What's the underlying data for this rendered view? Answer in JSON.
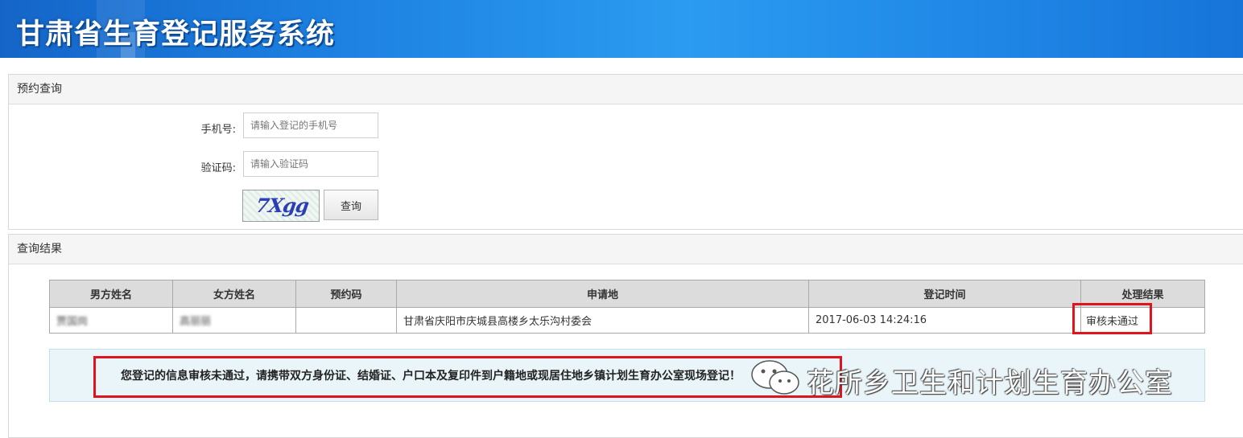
{
  "header": {
    "title": "甘肃省生育登记服务系统"
  },
  "query_panel": {
    "title": "预约查询",
    "phone_label": "手机号:",
    "phone_placeholder": "请输入登记的手机号",
    "code_label": "验证码:",
    "code_placeholder": "请输入验证码",
    "captcha_text": "7Xgg",
    "query_button": "查询"
  },
  "result_panel": {
    "title": "查询结果",
    "columns": [
      "男方姓名",
      "女方姓名",
      "预约码",
      "申请地",
      "登记时间",
      "处理结果"
    ],
    "rows": [
      {
        "male_name": "贾国岗",
        "female_name": "高丽丽",
        "code": "",
        "place": "甘肃省庆阳市庆城县高楼乡太乐沟村委会",
        "time": "2017-06-03 14:24:16",
        "result": "审核未通过"
      }
    ],
    "notice": "您登记的信息审核未通过，请携带双方身份证、结婚证、户口本及复印件到户籍地或现居住地乡镇计划生育办公室现场登记！"
  },
  "watermark": {
    "text": "花所乡卫生和计划生育办公室",
    "icon": "wechat-icon"
  },
  "colors": {
    "banner": "#1c7fe0",
    "highlight": "#e0141c",
    "notice_bg": "#e9f5f9"
  }
}
